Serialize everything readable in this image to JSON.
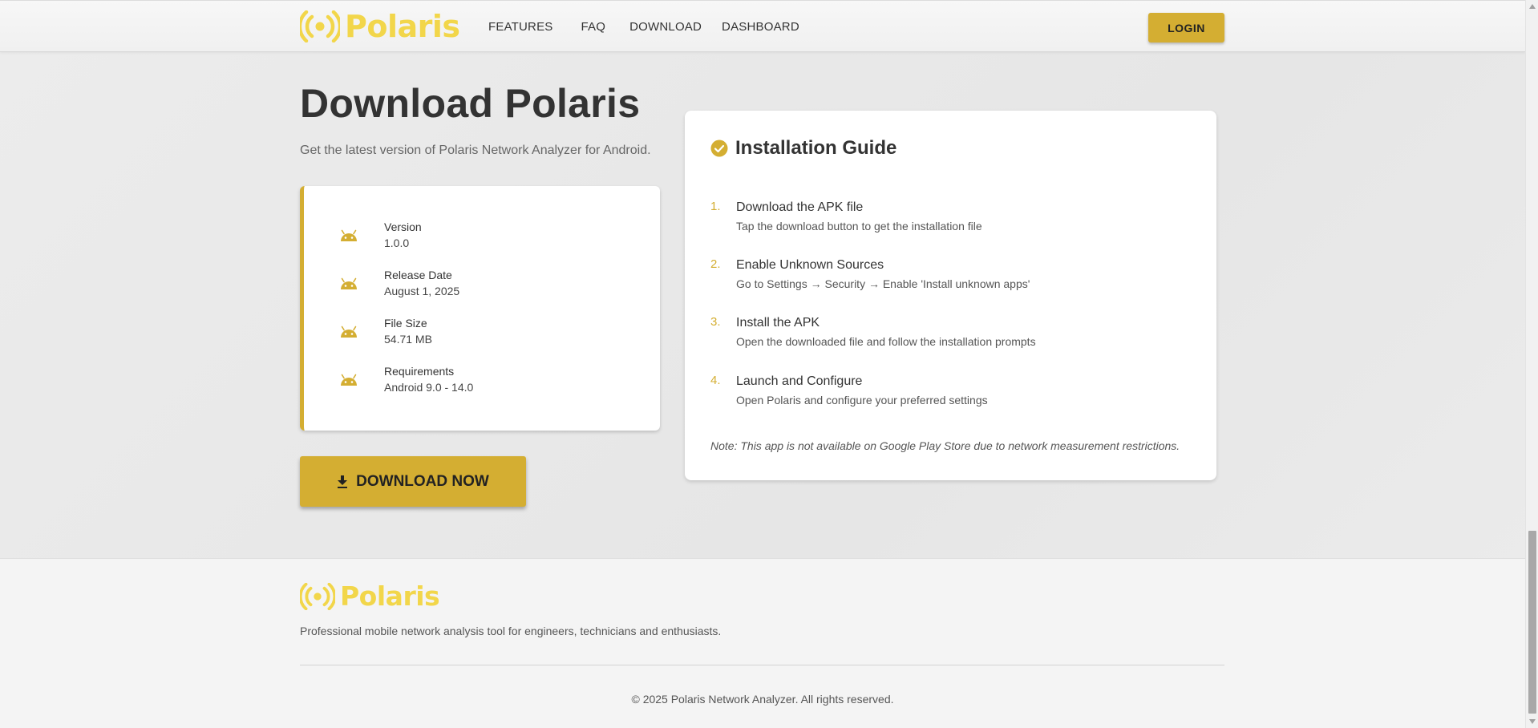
{
  "brand": {
    "name": "Polaris",
    "color": "#f2d64a"
  },
  "accent_color": "#d4ae32",
  "nav": {
    "items": [
      {
        "label": "FEATURES"
      },
      {
        "label": "FAQ"
      },
      {
        "label": "DOWNLOAD"
      },
      {
        "label": "DASHBOARD"
      }
    ],
    "login_label": "LOGIN"
  },
  "main": {
    "title": "Download Polaris",
    "subtitle": "Get the latest version of Polaris Network Analyzer for Android.",
    "info": [
      {
        "label": "Version",
        "value": "1.0.0",
        "icon": "android-icon"
      },
      {
        "label": "Release Date",
        "value": "August 1, 2025",
        "icon": "android-icon"
      },
      {
        "label": "File Size",
        "value": "54.71 MB",
        "icon": "android-icon"
      },
      {
        "label": "Requirements",
        "value": "Android 9.0 - 14.0",
        "icon": "android-icon"
      }
    ],
    "download_label": "DOWNLOAD NOW"
  },
  "guide": {
    "title": "Installation Guide",
    "steps": [
      {
        "num": "1.",
        "title": "Download the APK file",
        "desc": "Tap the download button to get the installation file"
      },
      {
        "num": "2.",
        "title": "Enable Unknown Sources",
        "desc": "Go to Settings → Security → Enable 'Install unknown apps'"
      },
      {
        "num": "3.",
        "title": "Install the APK",
        "desc": "Open the downloaded file and follow the installation prompts"
      },
      {
        "num": "4.",
        "title": "Launch and Configure",
        "desc": "Open Polaris and configure your preferred settings"
      }
    ],
    "note": "Note: This app is not available on Google Play Store due to network measurement restrictions."
  },
  "footer": {
    "tagline": "Professional mobile network analysis tool for engineers, technicians and enthusiasts.",
    "copyright": "© 2025 Polaris Network Analyzer. All rights reserved."
  }
}
